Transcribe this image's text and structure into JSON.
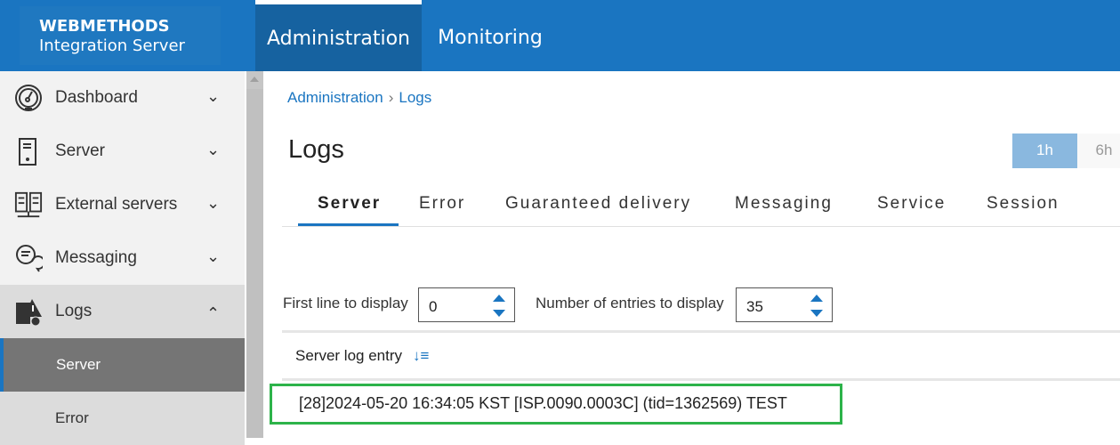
{
  "header": {
    "logo_line1": "WEBMETHODS",
    "logo_line2": "Integration Server",
    "tabs": [
      {
        "label": "Administration",
        "active": true
      },
      {
        "label": "Monitoring",
        "active": false
      }
    ]
  },
  "sidebar": {
    "items": [
      {
        "label": "Dashboard",
        "icon": "gauge-icon",
        "state": "collapsed"
      },
      {
        "label": "Server",
        "icon": "server-icon",
        "state": "collapsed"
      },
      {
        "label": "External servers",
        "icon": "servers-icon",
        "state": "collapsed"
      },
      {
        "label": "Messaging",
        "icon": "chat-icon",
        "state": "collapsed"
      },
      {
        "label": "Logs",
        "icon": "logs-warning-icon",
        "state": "expanded"
      }
    ],
    "subitems": [
      {
        "label": "Server",
        "selected": true
      },
      {
        "label": "Error",
        "selected": false
      }
    ]
  },
  "breadcrumb": [
    "Administration",
    "Logs"
  ],
  "page_title": "Logs",
  "time_ranges": [
    {
      "label": "1h",
      "active": true
    },
    {
      "label": "6h",
      "active": false
    }
  ],
  "tabs": [
    {
      "label": "Server",
      "active": true
    },
    {
      "label": "Error"
    },
    {
      "label": "Guaranteed delivery"
    },
    {
      "label": "Messaging"
    },
    {
      "label": "Service"
    },
    {
      "label": "Session"
    }
  ],
  "controls": {
    "first_line_label": "First line to display",
    "first_line_value": "0",
    "entries_label": "Number of entries to display",
    "entries_value": "35"
  },
  "table": {
    "column": "Server log entry",
    "rows": [
      "[28]2024-05-20 16:34:05 KST [ISP.0090.0003C] (tid=1362569) TEST"
    ]
  },
  "colors": {
    "accent": "#1a75c1",
    "highlight": "#2db34a"
  }
}
